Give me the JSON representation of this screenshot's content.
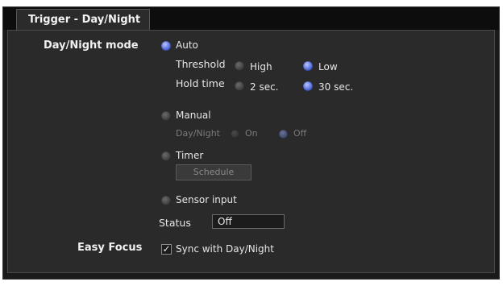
{
  "tab": {
    "title": "Trigger - Day/Night"
  },
  "day_night_mode": {
    "label": "Day/Night mode",
    "auto": {
      "label": "Auto",
      "selected": true,
      "threshold": {
        "label": "Threshold",
        "options": [
          "High",
          "Low"
        ],
        "selected": "Low"
      },
      "hold_time": {
        "label": "Hold time",
        "options": [
          "2 sec.",
          "30 sec."
        ],
        "selected": "30 sec."
      }
    },
    "manual": {
      "label": "Manual",
      "selected": false,
      "day_night": {
        "label": "Day/Night",
        "options": [
          "On",
          "Off"
        ],
        "selected": "Off",
        "disabled": true
      }
    },
    "timer": {
      "label": "Timer",
      "selected": false,
      "schedule_button": "Schedule"
    },
    "sensor_input": {
      "label": "Sensor input",
      "selected": false
    },
    "status": {
      "label": "Status",
      "value": "Off"
    }
  },
  "easy_focus": {
    "label": "Easy Focus",
    "sync": {
      "label": "Sync with Day/Night",
      "checked": true
    }
  },
  "colors": {
    "accent_radio": "#4f66d6",
    "panel": "#2a2a2a",
    "background": "#1a1a1a"
  }
}
